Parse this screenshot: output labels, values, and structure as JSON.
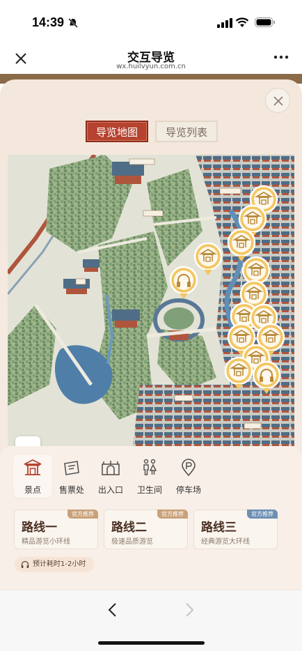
{
  "status": {
    "time": "14:39"
  },
  "nav": {
    "title": "交互导览",
    "url": "wx.huilvyun.com.cn"
  },
  "view_tabs": {
    "map": "导览地图",
    "list": "导览列表"
  },
  "zoom": {
    "in": "+",
    "out": "−"
  },
  "categories": [
    {
      "label": "景点",
      "icon": "pavilion-icon",
      "active": true
    },
    {
      "label": "售票处",
      "icon": "ticket-icon",
      "active": false
    },
    {
      "label": "出入口",
      "icon": "gate-icon",
      "active": false
    },
    {
      "label": "卫生间",
      "icon": "restroom-icon",
      "active": false
    },
    {
      "label": "停车场",
      "icon": "parking-icon",
      "active": false
    }
  ],
  "routes": [
    {
      "title": "路线一",
      "desc": "精品游览小环线",
      "badge": "官方推荐",
      "badge_color": "#c9a27a"
    },
    {
      "title": "路线二",
      "desc": "极速品质游览",
      "badge": "官方推荐",
      "badge_color": "#c9a27a"
    },
    {
      "title": "路线三",
      "desc": "经典游览大环线",
      "badge": "官方推荐",
      "badge_color": "#6d8fb3"
    }
  ],
  "time_hint": "预计耗时1-2小时",
  "colors": {
    "accent": "#b5432f",
    "marker": "#e6b04a",
    "sheet_bg": "#f4e7dc"
  }
}
